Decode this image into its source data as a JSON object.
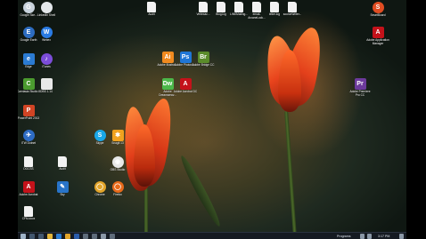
{
  "desktop_icons": [
    {
      "key": "google-sketchup",
      "label": "Google Ske...",
      "color": "#c8d2dc",
      "text": "G",
      "round": true
    },
    {
      "key": "pdf-shell",
      "label": "LinkedIn Shell",
      "color": "#e3e7ea",
      "text": "",
      "round": true
    },
    {
      "key": "google-earth",
      "label": "Google Earth",
      "color": "#2d6cc0",
      "text": "E",
      "round": true
    },
    {
      "key": "webex",
      "label": "Webex",
      "color": "#2a7be4",
      "text": "W",
      "round": true
    },
    {
      "key": "edge",
      "label": "Edge",
      "color": "#2b7bd3",
      "text": "e"
    },
    {
      "key": "itunes",
      "label": "iTunes",
      "color": "#7c4dd9",
      "text": "♪",
      "round": true
    },
    {
      "key": "camtasia",
      "label": "Camtasia Studio 8",
      "color": "#4b9b2f",
      "text": "C"
    },
    {
      "key": "shortcut",
      "label": "DBS 1.14",
      "color": "#e8e8e8",
      "text": ""
    },
    {
      "key": "powerpoint",
      "label": "PowerPoint 2013",
      "color": "#d14424",
      "text": "P"
    },
    {
      "key": "itwork",
      "label": "ITW Dotnet",
      "color": "#2e6cc4",
      "text": "✈",
      "round": true
    },
    {
      "key": "blank-doc",
      "label": "DOCSS",
      "color": "#f2f2f2",
      "text": "",
      "file": true
    },
    {
      "key": "acrobat",
      "label": "Adobe Acrobat",
      "color": "#c4121a",
      "text": "A"
    },
    {
      "key": "skype",
      "label": "Skype",
      "color": "#19a7e8",
      "text": "S",
      "round": true
    },
    {
      "key": "snagit",
      "label": "Snagit 13",
      "color": "#f0a21f",
      "text": "✱"
    },
    {
      "key": "illustrator",
      "label": "Adobe Illustrat...",
      "color": "#f08a1f",
      "text": "Ai"
    },
    {
      "key": "photoshop",
      "label": "Adobe Photosh...",
      "color": "#1f76d6",
      "text": "Ps"
    },
    {
      "key": "dreamweaver",
      "label": "Adobe Dreamweav...",
      "color": "#4cb84a",
      "text": "Dw"
    },
    {
      "key": "acrobat-pro",
      "label": "Adobe Acrobat DC",
      "color": "#c4121a",
      "text": "A"
    },
    {
      "key": "unknown-app",
      "label": "Adobe Bridge CC",
      "color": "#5a8b2a",
      "text": "Br"
    },
    {
      "key": "obs",
      "label": "OBS Studio",
      "color": "#e8e8e8",
      "text": "◉",
      "round": true
    },
    {
      "key": "chrome",
      "label": "Chrome",
      "color": "#e2a42a",
      "text": "◯",
      "round": true
    },
    {
      "key": "firefox",
      "label": "Firefox",
      "color": "#e86a1a",
      "text": "◯",
      "round": true
    },
    {
      "key": "doc2",
      "label": "Audit",
      "color": "#f2f2f2",
      "text": "",
      "file": true
    },
    {
      "key": "paper-tool",
      "label": "Sky",
      "color": "#2874c9",
      "text": "✎"
    },
    {
      "key": "doc3",
      "label": "CFM.docx",
      "color": "#f2f2f2",
      "text": "",
      "file": true
    },
    {
      "key": "smartboard",
      "label": "SmartBoard",
      "color": "#e04d22",
      "text": "S",
      "round": true
    },
    {
      "key": "adobe-manager",
      "label": "Adobe Application Manager",
      "color": "#c4121a",
      "text": "A"
    },
    {
      "key": "premiere",
      "label": "Adobe Premiere Pro CC",
      "color": "#6c3a9c",
      "text": "Pr"
    },
    {
      "key": "top-file1",
      "label": "Audit",
      "color": "#f2f2f2",
      "text": "",
      "file": true
    },
    {
      "key": "top-file2",
      "label": "Vertexac...",
      "color": "#f2f2f2",
      "text": "",
      "file": true
    },
    {
      "key": "top-file3",
      "label": "Blog.log",
      "color": "#f2f2f2",
      "text": "",
      "file": true
    },
    {
      "key": "top-file4",
      "label": "LINKMailing...",
      "color": "#f2f2f2",
      "text": "",
      "file": true
    },
    {
      "key": "top-file5",
      "label": "email-ArcaneLock...",
      "color": "#f2f2f2",
      "text": "",
      "file": true
    },
    {
      "key": "top-file6",
      "label": "letter.log",
      "color": "#f2f2f2",
      "text": "",
      "file": true
    },
    {
      "key": "top-file7",
      "label": "sourceWriter...",
      "color": "#f2f2f2",
      "text": "",
      "file": true
    }
  ],
  "taskbar": {
    "programs_label": "Programs",
    "clock": "3:17 PM"
  },
  "colors": {
    "tulip_red": "#e8431c",
    "tulip_orange": "#ff7a2a",
    "taskbar_bg": "#151a22"
  }
}
